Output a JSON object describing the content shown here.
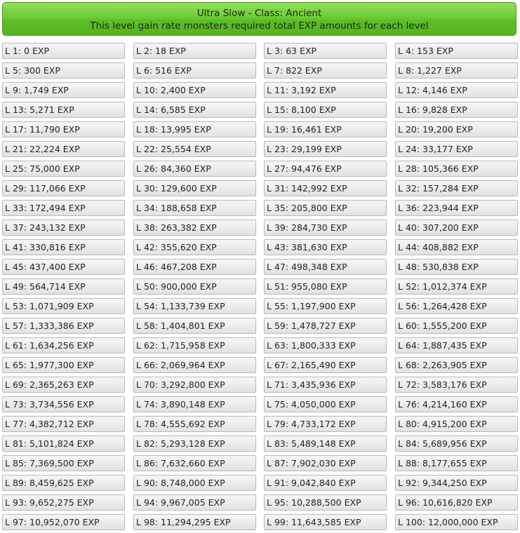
{
  "header": {
    "title": "Ultra Slow - Class: Ancient",
    "subtitle": "This level gain rate monsters required total EXP amounts for each level",
    "color": "#6ecb35"
  },
  "levels": [
    "L 1: 0 EXP",
    "L 2: 18 EXP",
    "L 3: 63 EXP",
    "L 4: 153 EXP",
    "L 5: 300 EXP",
    "L 6: 516 EXP",
    "L 7: 822 EXP",
    "L 8: 1,227 EXP",
    "L 9: 1,749 EXP",
    "L 10: 2,400 EXP",
    "L 11: 3,192 EXP",
    "L 12: 4,146 EXP",
    "L 13: 5,271 EXP",
    "L 14: 6,585 EXP",
    "L 15: 8,100 EXP",
    "L 16: 9,828 EXP",
    "L 17: 11,790 EXP",
    "L 18: 13,995 EXP",
    "L 19: 16,461 EXP",
    "L 20: 19,200 EXP",
    "L 21: 22,224 EXP",
    "L 22: 25,554 EXP",
    "L 23: 29,199 EXP",
    "L 24: 33,177 EXP",
    "L 25: 75,000 EXP",
    "L 26: 84,360 EXP",
    "L 27: 94,476 EXP",
    "L 28: 105,366 EXP",
    "L 29: 117,066 EXP",
    "L 30: 129,600 EXP",
    "L 31: 142,992 EXP",
    "L 32: 157,284 EXP",
    "L 33: 172,494 EXP",
    "L 34: 188,658 EXP",
    "L 35: 205,800 EXP",
    "L 36: 223,944 EXP",
    "L 37: 243,132 EXP",
    "L 38: 263,382 EXP",
    "L 39: 284,730 EXP",
    "L 40: 307,200 EXP",
    "L 41: 330,816 EXP",
    "L 42: 355,620 EXP",
    "L 43: 381,630 EXP",
    "L 44: 408,882 EXP",
    "L 45: 437,400 EXP",
    "L 46: 467,208 EXP",
    "L 47: 498,348 EXP",
    "L 48: 530,838 EXP",
    "L 49: 564,714 EXP",
    "L 50: 900,000 EXP",
    "L 51: 955,080 EXP",
    "L 52: 1,012,374 EXP",
    "L 53: 1,071,909 EXP",
    "L 54: 1,133,739 EXP",
    "L 55: 1,197,900 EXP",
    "L 56: 1,264,428 EXP",
    "L 57: 1,333,386 EXP",
    "L 58: 1,404,801 EXP",
    "L 59: 1,478,727 EXP",
    "L 60: 1,555,200 EXP",
    "L 61: 1,634,256 EXP",
    "L 62: 1,715,958 EXP",
    "L 63: 1,800,333 EXP",
    "L 64: 1,887,435 EXP",
    "L 65: 1,977,300 EXP",
    "L 66: 2,069,964 EXP",
    "L 67: 2,165,490 EXP",
    "L 68: 2,263,905 EXP",
    "L 69: 2,365,263 EXP",
    "L 70: 3,292,800 EXP",
    "L 71: 3,435,936 EXP",
    "L 72: 3,583,176 EXP",
    "L 73: 3,734,556 EXP",
    "L 74: 3,890,148 EXP",
    "L 75: 4,050,000 EXP",
    "L 76: 4,214,160 EXP",
    "L 77: 4,382,712 EXP",
    "L 78: 4,555,692 EXP",
    "L 79: 4,733,172 EXP",
    "L 80: 4,915,200 EXP",
    "L 81: 5,101,824 EXP",
    "L 82: 5,293,128 EXP",
    "L 83: 5,489,148 EXP",
    "L 84: 5,689,956 EXP",
    "L 85: 7,369,500 EXP",
    "L 86: 7,632,660 EXP",
    "L 87: 7,902,030 EXP",
    "L 88: 8,177,655 EXP",
    "L 89: 8,459,625 EXP",
    "L 90: 8,748,000 EXP",
    "L 91: 9,042,840 EXP",
    "L 92: 9,344,250 EXP",
    "L 93: 9,652,275 EXP",
    "L 94: 9,967,005 EXP",
    "L 95: 10,288,500 EXP",
    "L 96: 10,616,820 EXP",
    "L 97: 10,952,070 EXP",
    "L 98: 11,294,295 EXP",
    "L 99: 11,643,585 EXP",
    "L 100: 12,000,000 EXP"
  ]
}
